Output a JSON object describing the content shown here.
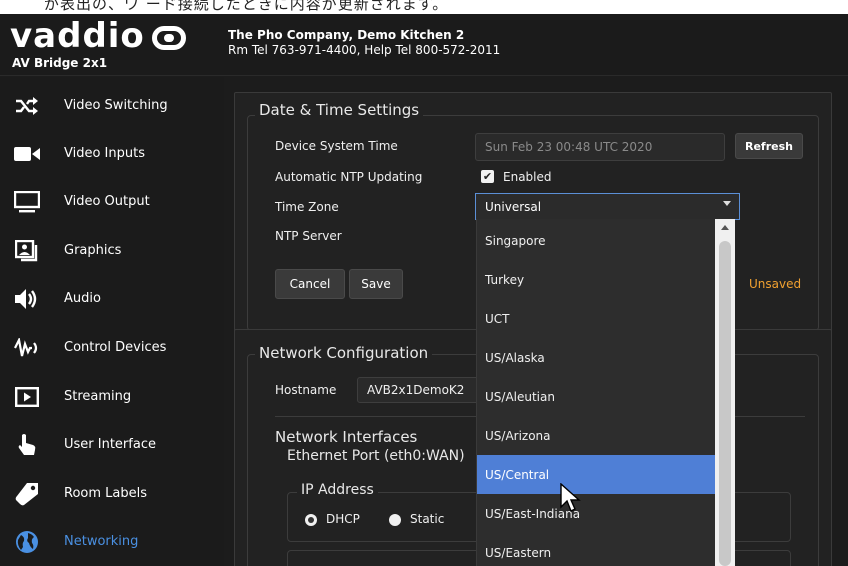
{
  "top_strip": {
    "text": "が表出の、ワ ード接続したときに内容が更新されます。"
  },
  "header": {
    "logo": "vaddio",
    "model": "AV Bridge 2x1",
    "company_line": "The Pho Company, Demo Kitchen 2",
    "contact_line": "Rm Tel 763-971-4400, Help Tel 800-572-2011"
  },
  "sidebar": {
    "items": [
      {
        "label": "Video Switching",
        "icon": "shuffle-icon"
      },
      {
        "label": "Video Inputs",
        "icon": "video-camera-icon"
      },
      {
        "label": "Video Output",
        "icon": "monitor-icon"
      },
      {
        "label": "Graphics",
        "icon": "graphics-icon"
      },
      {
        "label": "Audio",
        "icon": "speaker-icon"
      },
      {
        "label": "Control Devices",
        "icon": "control-signal-icon"
      },
      {
        "label": "Streaming",
        "icon": "play-icon"
      },
      {
        "label": "User Interface",
        "icon": "hand-pointer-icon"
      },
      {
        "label": "Room Labels",
        "icon": "tag-icon"
      },
      {
        "label": "Networking",
        "icon": "globe-icon",
        "active": true
      }
    ]
  },
  "datetime": {
    "title": "Date & Time Settings",
    "system_time_label": "Device System Time",
    "system_time_value": "Sun Feb 23 00:48 UTC 2020",
    "refresh_label": "Refresh",
    "ntp_label": "Automatic NTP Updating",
    "ntp_checkbox_label": "Enabled",
    "timezone_label": "Time Zone",
    "timezone_value": "Universal",
    "ntp_server_label": "NTP Server",
    "cancel_label": "Cancel",
    "save_label": "Save",
    "unsaved_label": "Unsaved"
  },
  "network": {
    "title": "Network Configuration",
    "hostname_label": "Hostname",
    "hostname_value": "AVB2x1DemoK2",
    "interfaces_title": "Network Interfaces",
    "ethernet_port_label": "Ethernet Port (eth0:WAN)",
    "ip_address_title": "IP Address",
    "dhcp_label": "DHCP",
    "static_label": "Static"
  },
  "timezone_dropdown": {
    "options": [
      "Singapore",
      "Turkey",
      "UCT",
      "US/Alaska",
      "US/Aleutian",
      "US/Arizona",
      "US/Central",
      "US/East-Indiana",
      "US/Eastern"
    ],
    "highlighted": "US/Central"
  },
  "colors": {
    "accent": "#4a90e2",
    "selected": "#4f7fd6",
    "unsaved": "#f0a030"
  }
}
